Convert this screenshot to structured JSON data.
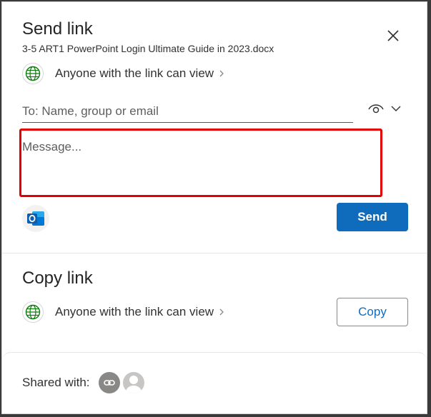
{
  "dialog": {
    "title": "Send link",
    "filename": "3-5 ART1 PowerPoint Login Ultimate Guide in 2023.docx",
    "close_icon": "close-icon"
  },
  "send_section": {
    "permission_text": "Anyone with the link can view",
    "to_placeholder": "To: Name, group or email",
    "message_placeholder": "Message...",
    "send_label": "Send",
    "accent_color": "#0f6cbd",
    "highlight_color": "#e30000"
  },
  "copy_section": {
    "title": "Copy link",
    "permission_text": "Anyone with the link can view",
    "copy_label": "Copy"
  },
  "shared": {
    "label": "Shared with:"
  }
}
